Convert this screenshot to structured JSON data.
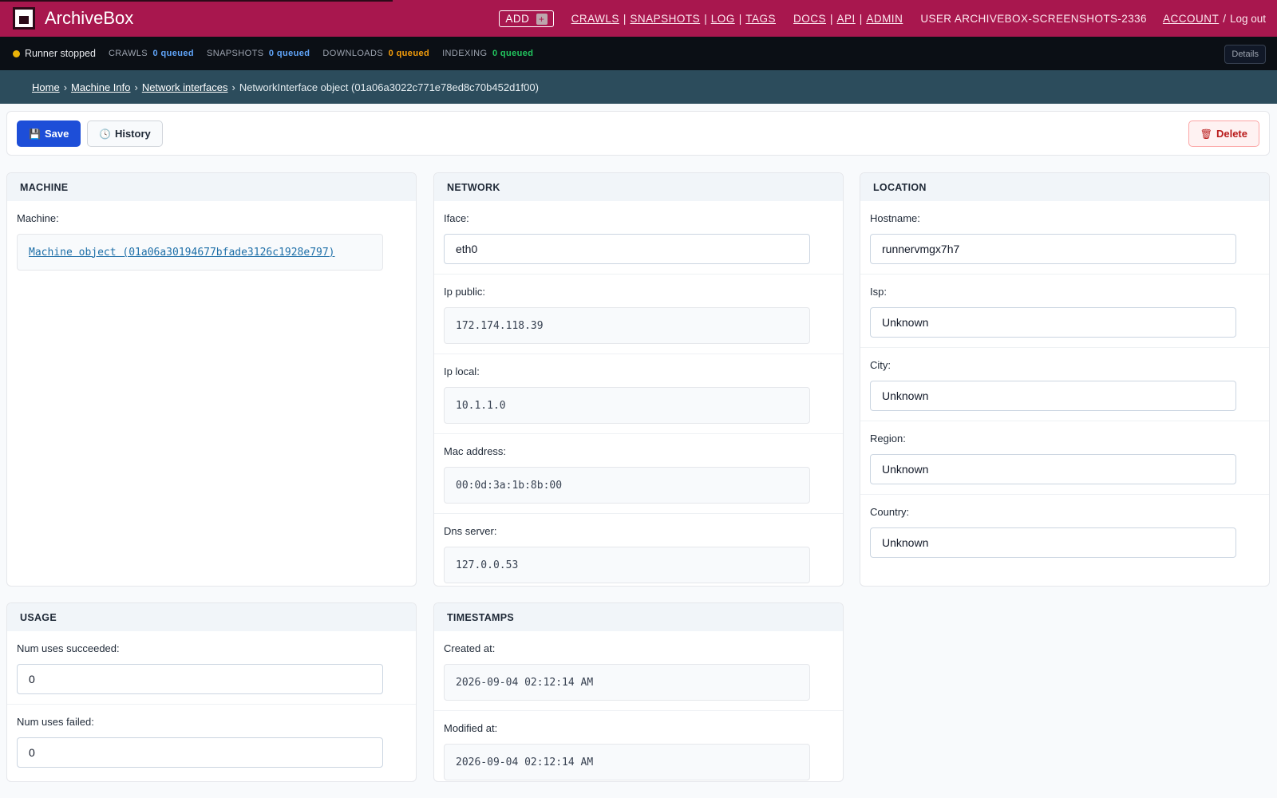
{
  "app": {
    "brand": "ArchiveBox"
  },
  "nav": {
    "add_label": "ADD",
    "add_icon": "plus-icon",
    "crawls": "CRAWLS",
    "snapshots": "SNAPSHOTS",
    "log": "LOG",
    "tags": "TAGS",
    "docs": "DOCS",
    "api": "API",
    "admin": "ADMIN",
    "user": "USER ARCHIVEBOX-SCREENSHOTS-2336",
    "account": "ACCOUNT",
    "logout": "Log out",
    "sep": "|",
    "slash": "/"
  },
  "status": {
    "runner": "Runner stopped",
    "crawls_label": "CRAWLS",
    "crawls_value": "0 queued",
    "snapshots_label": "SNAPSHOTS",
    "snapshots_value": "0 queued",
    "downloads_label": "DOWNLOADS",
    "downloads_value": "0 queued",
    "indexing_label": "INDEXING",
    "indexing_value": "0 queued",
    "details": "Details",
    "colors": {
      "runner_dot": "#eab308",
      "blue": "#60a5fa",
      "orange": "#f59e0b",
      "green": "#22c55e"
    }
  },
  "breadcrumb": {
    "home": "Home",
    "machine_info": "Machine Info",
    "network_interfaces": "Network interfaces",
    "current": "NetworkInterface object (01a06a3022c771e78ed8c70b452d1f00)",
    "sep": "›"
  },
  "toolbar": {
    "save": "Save",
    "history": "History",
    "delete": "Delete"
  },
  "machine": {
    "title": "MACHINE",
    "machine_label": "Machine:",
    "machine_value": "Machine object (01a06a30194677bfade3126c1928e797)"
  },
  "network": {
    "title": "NETWORK",
    "iface_label": "Iface:",
    "iface_value": "eth0",
    "ip_public_label": "Ip public:",
    "ip_public_value": "172.174.118.39",
    "ip_local_label": "Ip local:",
    "ip_local_value": "10.1.1.0",
    "mac_label": "Mac address:",
    "mac_value": "00:0d:3a:1b:8b:00",
    "dns_label": "Dns server:",
    "dns_value": "127.0.0.53"
  },
  "location": {
    "title": "LOCATION",
    "hostname_label": "Hostname:",
    "hostname_value": "runnervmgx7h7",
    "isp_label": "Isp:",
    "isp_value": "Unknown",
    "city_label": "City:",
    "city_value": "Unknown",
    "region_label": "Region:",
    "region_value": "Unknown",
    "country_label": "Country:",
    "country_value": "Unknown"
  },
  "usage": {
    "title": "USAGE",
    "succeeded_label": "Num uses succeeded:",
    "succeeded_value": "0",
    "failed_label": "Num uses failed:",
    "failed_value": "0"
  },
  "timestamps": {
    "title": "TIMESTAMPS",
    "created_label": "Created at:",
    "created_value": "2026-09-04 02:12:14 AM",
    "modified_label": "Modified at:",
    "modified_value": "2026-09-04 02:12:14 AM"
  }
}
